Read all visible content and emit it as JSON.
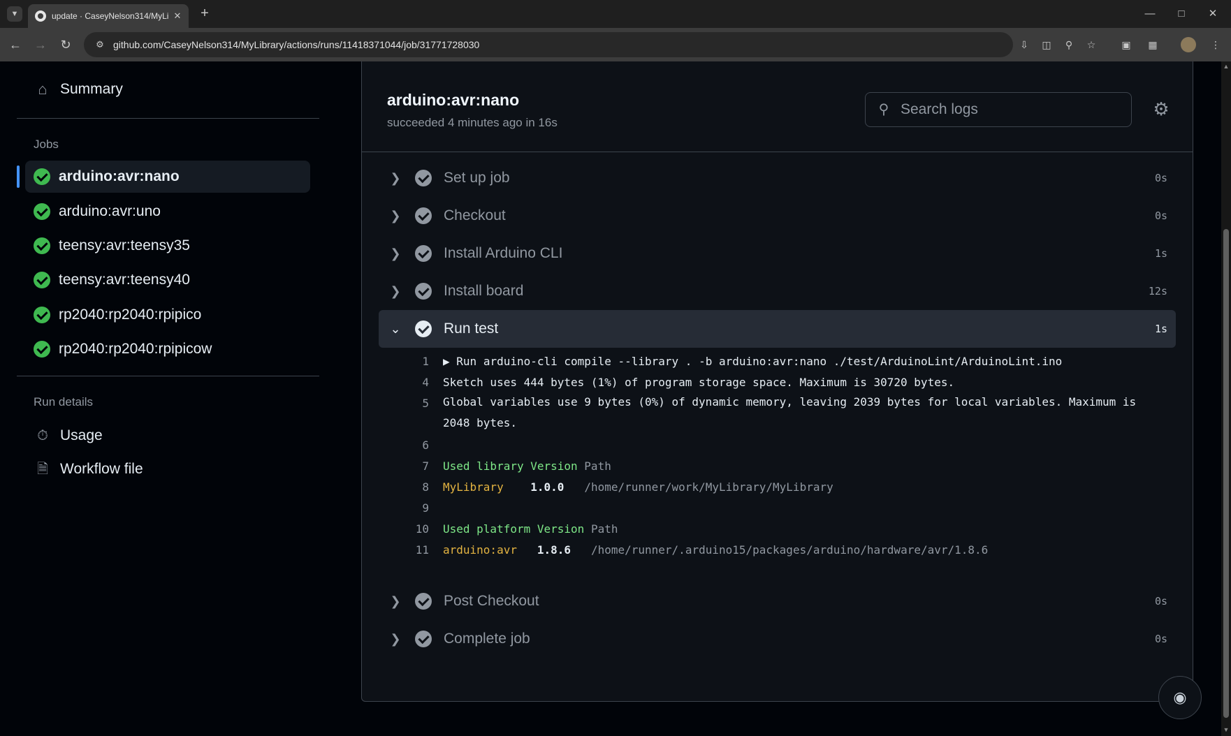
{
  "browser": {
    "tab_title": "update · CaseyNelson314/MyLi",
    "url": "github.com/CaseyNelson314/MyLibrary/actions/runs/11418371044/job/31771728030"
  },
  "sidebar": {
    "summary_label": "Summary",
    "jobs_heading": "Jobs",
    "jobs": [
      {
        "label": "arduino:avr:nano"
      },
      {
        "label": "arduino:avr:uno"
      },
      {
        "label": "teensy:avr:teensy35"
      },
      {
        "label": "teensy:avr:teensy40"
      },
      {
        "label": "rp2040:rp2040:rpipico"
      },
      {
        "label": "rp2040:rp2040:rpipicow"
      }
    ],
    "run_details_heading": "Run details",
    "usage_label": "Usage",
    "workflow_file_label": "Workflow file"
  },
  "job": {
    "title": "arduino:avr:nano",
    "status": "succeeded 4 minutes ago in 16s",
    "search_placeholder": "Search logs"
  },
  "steps": [
    {
      "label": "Set up job",
      "duration": "0s"
    },
    {
      "label": "Checkout",
      "duration": "0s"
    },
    {
      "label": "Install Arduino CLI",
      "duration": "1s"
    },
    {
      "label": "Install board",
      "duration": "12s"
    },
    {
      "label": "Run test",
      "duration": "1s"
    },
    {
      "label": "Post Checkout",
      "duration": "0s"
    },
    {
      "label": "Complete job",
      "duration": "0s"
    }
  ],
  "log": {
    "l1": {
      "n": "1",
      "text": "Run arduino-cli compile --library . -b arduino:avr:nano ./test/ArduinoLint/ArduinoLint.ino"
    },
    "l4": {
      "n": "4",
      "text": "Sketch uses 444 bytes (1%) of program storage space. Maximum is 30720 bytes."
    },
    "l5": {
      "n": "5",
      "text": "Global variables use 9 bytes (0%) of dynamic memory, leaving 2039 bytes for local variables. Maximum is 2048 bytes."
    },
    "l6": {
      "n": "6"
    },
    "l7": {
      "n": "7",
      "a": "Used library Version",
      "b": "Path"
    },
    "l8": {
      "n": "8",
      "a": "MyLibrary",
      "b": "1.0.0",
      "c": "/home/runner/work/MyLibrary/MyLibrary"
    },
    "l9": {
      "n": "9"
    },
    "l10": {
      "n": "10",
      "a": "Used platform Version",
      "b": "Path"
    },
    "l11": {
      "n": "11",
      "a": "arduino:avr",
      "b": "1.8.6",
      "c": "/home/runner/.arduino15/packages/arduino/hardware/avr/1.8.6"
    }
  }
}
